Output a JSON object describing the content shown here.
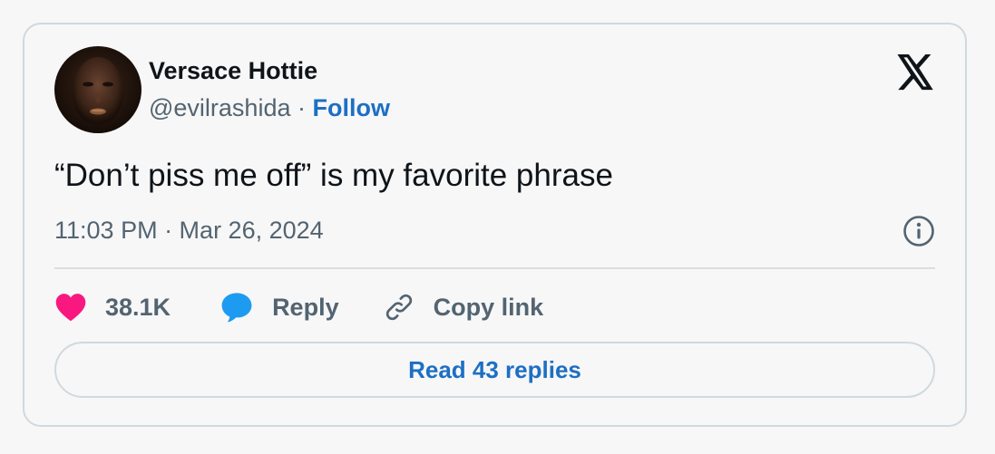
{
  "author": {
    "display_name": "Versace Hottie",
    "handle": "@evilrashida",
    "separator": "·",
    "follow_label": "Follow",
    "avatar_icon": "avatar-photo"
  },
  "brand": {
    "logo_icon": "x-logo-icon"
  },
  "tweet": {
    "text": "“Don’t piss me off” is my favorite phrase",
    "timestamp": "11:03 PM · Mar 26, 2024"
  },
  "actions": {
    "like_count": "38.1K",
    "reply_label": "Reply",
    "copy_link_label": "Copy link"
  },
  "footer": {
    "read_replies_label": "Read 43 replies"
  },
  "colors": {
    "accent": "#1d6fc4",
    "like": "#f91880",
    "reply_icon": "#1d9bf0",
    "text_primary": "#0f1419",
    "text_secondary": "#536471",
    "border": "#cfd9de"
  }
}
